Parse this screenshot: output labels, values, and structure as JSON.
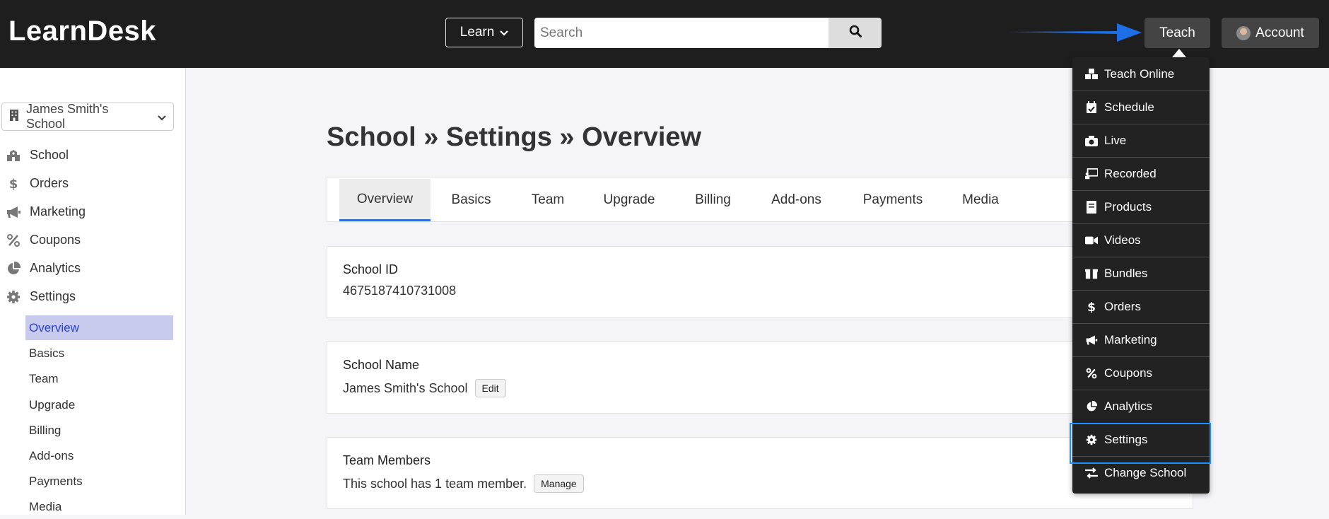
{
  "app": {
    "logo": "LearnDesk"
  },
  "header": {
    "learn_label": "Learn",
    "search_placeholder": "Search",
    "teach_label": "Teach",
    "account_label": "Account"
  },
  "sidebar": {
    "school_name": "James Smith's School",
    "items": [
      {
        "label": "School",
        "icon": "school-icon"
      },
      {
        "label": "Orders",
        "icon": "dollar-icon"
      },
      {
        "label": "Marketing",
        "icon": "megaphone-icon"
      },
      {
        "label": "Coupons",
        "icon": "percent-icon"
      },
      {
        "label": "Analytics",
        "icon": "pie-chart-icon"
      },
      {
        "label": "Settings",
        "icon": "gear-icon"
      }
    ],
    "settings_subitems": [
      "Overview",
      "Basics",
      "Team",
      "Upgrade",
      "Billing",
      "Add-ons",
      "Payments",
      "Media"
    ],
    "active_subitem": "Overview"
  },
  "main": {
    "title": "School » Settings » Overview",
    "tabs": [
      "Overview",
      "Basics",
      "Team",
      "Upgrade",
      "Billing",
      "Add-ons",
      "Payments",
      "Media"
    ],
    "active_tab": "Overview",
    "cards": {
      "school_id": {
        "label": "School ID",
        "value": "4675187410731008"
      },
      "school_name": {
        "label": "School Name",
        "value": "James Smith's School",
        "button": "Edit"
      },
      "team_members": {
        "label": "Team Members",
        "value": "This school has 1 team member.",
        "button": "Manage"
      }
    }
  },
  "teach_menu": {
    "items": [
      {
        "label": "Teach Online",
        "icon": "cubes-icon"
      },
      {
        "label": "Schedule",
        "icon": "calendar-check-icon"
      },
      {
        "label": "Live",
        "icon": "camera-icon"
      },
      {
        "label": "Recorded",
        "icon": "presentation-icon"
      },
      {
        "label": "Products",
        "icon": "book-icon"
      },
      {
        "label": "Videos",
        "icon": "video-icon"
      },
      {
        "label": "Bundles",
        "icon": "boxes-icon"
      },
      {
        "label": "Orders",
        "icon": "dollar-icon"
      },
      {
        "label": "Marketing",
        "icon": "megaphone-icon"
      },
      {
        "label": "Coupons",
        "icon": "percent-icon"
      },
      {
        "label": "Analytics",
        "icon": "pie-chart-icon"
      },
      {
        "label": "Settings",
        "icon": "gear-icon"
      },
      {
        "label": "Change School",
        "icon": "exchange-icon"
      }
    ],
    "highlighted": "Settings"
  },
  "colors": {
    "topbar": "#1e1e1e",
    "active_tab_underline": "#2f6fd6",
    "active_sidebar_bg": "#c8cbee",
    "highlight_border": "#1e90ff",
    "annotation_arrow": "#1e6fe6"
  }
}
